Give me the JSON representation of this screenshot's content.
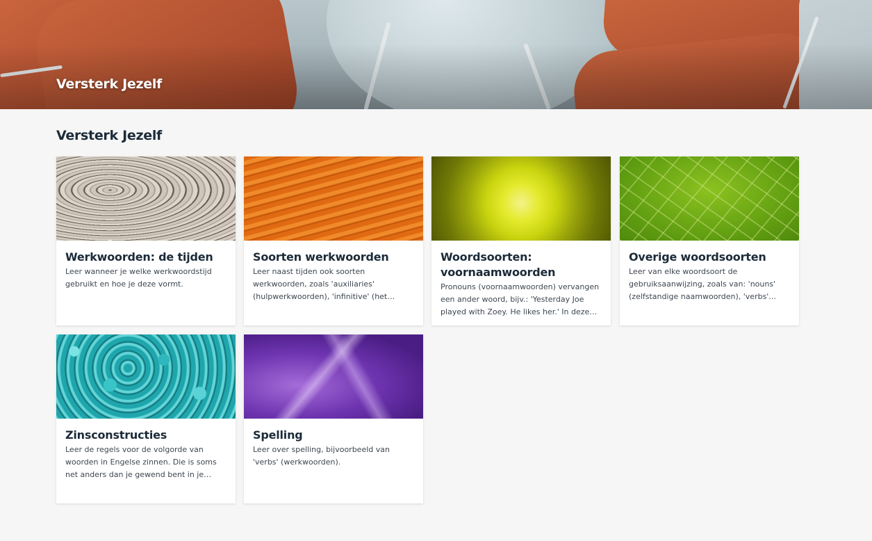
{
  "hero": {
    "title": "Versterk Jezelf"
  },
  "section": {
    "title": "Versterk Jezelf"
  },
  "cards": [
    {
      "title": "Werkwoorden: de tijden",
      "description": "Leer wanneer je welke werkwoordstijd gebruikt en hoe je deze vormt.",
      "image": "wood-texture"
    },
    {
      "title": "Soorten werkwoorden",
      "description": "Leer naast tijden ook soorten werkwoorden, zoals 'auxiliaries' (hulpwerkwoorden), 'infinitive' (het infinitief) en de 'gerund' (l...",
      "image": "sand-dunes"
    },
    {
      "title": "Woordsoorten: voornaamwoorden",
      "description": "Pronouns (voornaamwoorden) vervangen een ander woord, bijv.: 'Yesterday Joe played with Zoey. He likes her.' In deze zin...",
      "image": "sunflower-center"
    },
    {
      "title": "Overige woordsoorten",
      "description": "Leer van elke woordsoort de gebruiksaanwijzing, zoals van: 'nouns' (zelfstandige naamwoorden), 'verbs'...",
      "image": "green-leaf"
    },
    {
      "title": "Zinsconstructies",
      "description": "Leer de regels voor de volgorde van woorden in Engelse zinnen. Die is soms net anders dan je gewend bent in je eigen taal.",
      "image": "turquoise-stones"
    },
    {
      "title": "Spelling",
      "description": "Leer over spelling, bijvoorbeeld van 'verbs' (werkwoorden).",
      "image": "amethyst-crystals"
    }
  ]
}
